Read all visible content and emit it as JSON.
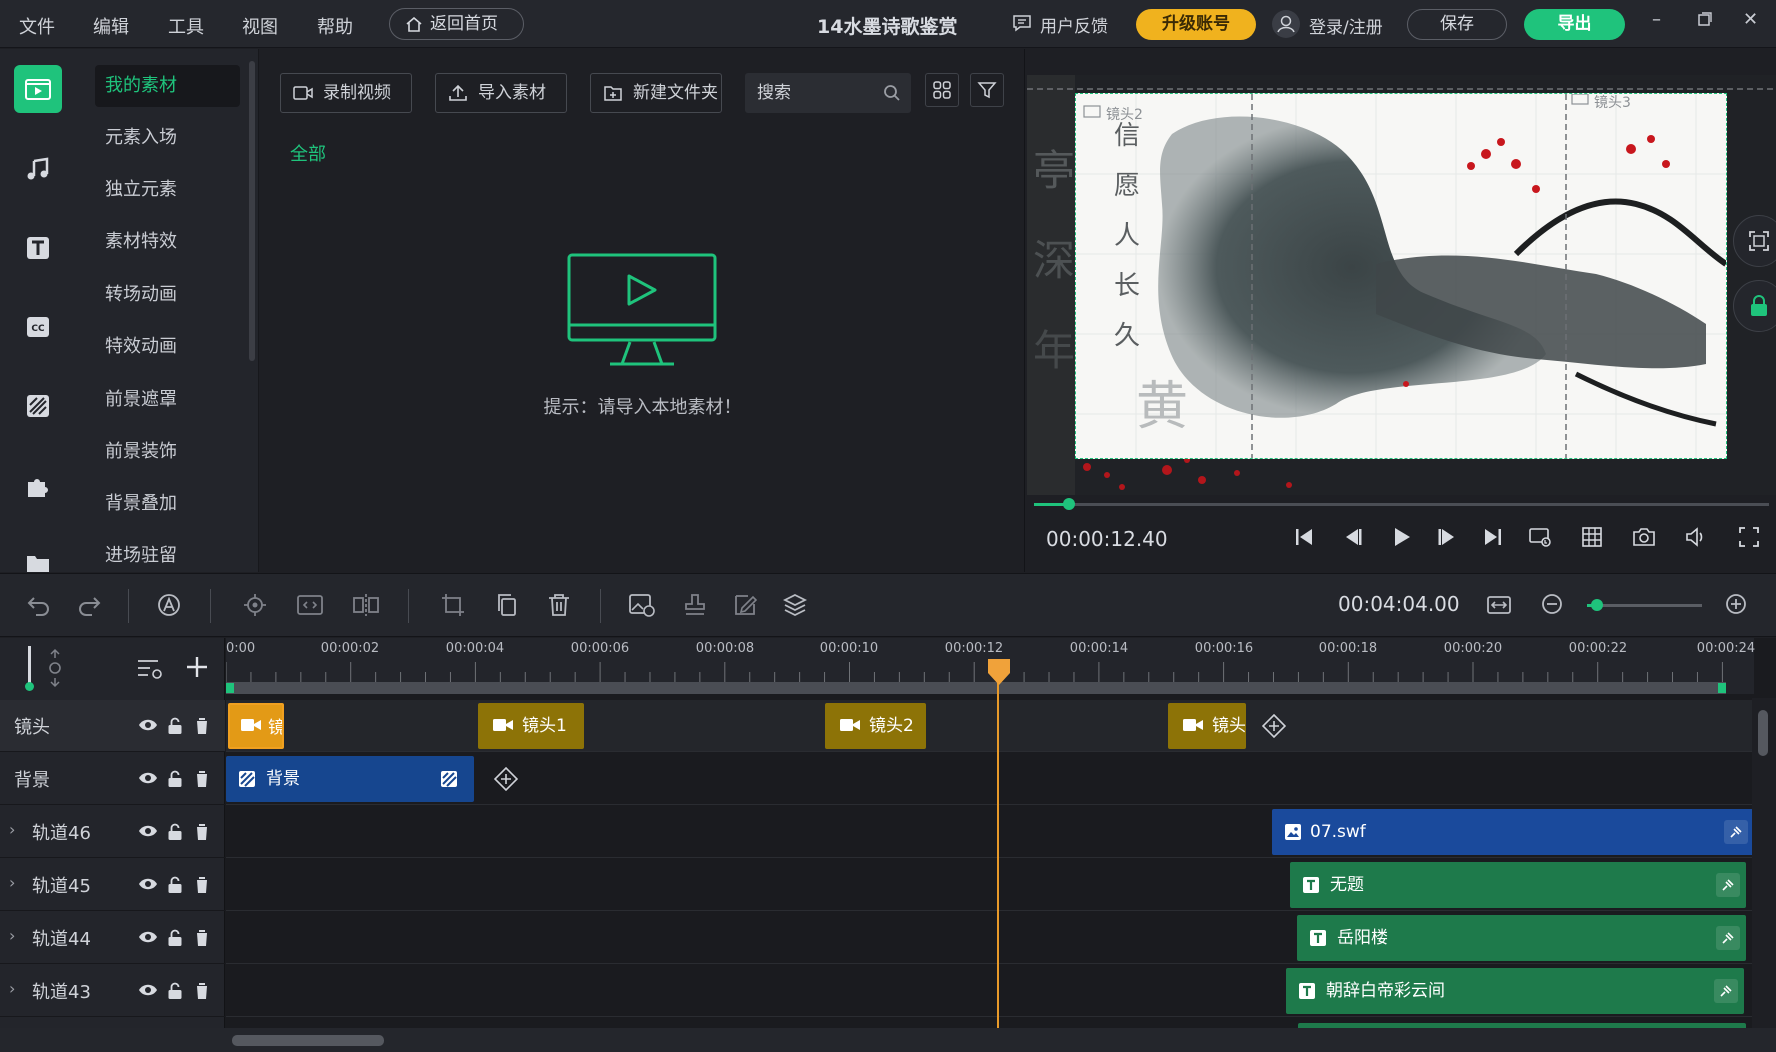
{
  "menu": {
    "items": [
      "文件",
      "编辑",
      "工具",
      "视图",
      "帮助"
    ],
    "home_button": "返回首页",
    "title": "14水墨诗歌鉴赏",
    "feedback": "用户反馈",
    "upgrade": "升级账号",
    "login": "登录/注册",
    "save": "保存",
    "export": "导出"
  },
  "sidebar": {
    "categories": [
      "我的素材",
      "元素入场",
      "独立元素",
      "素材特效",
      "转场动画",
      "特效动画",
      "前景遮罩",
      "前景装饰",
      "背景叠加",
      "进场驻留"
    ]
  },
  "media": {
    "record": "录制视频",
    "import": "导入素材",
    "new_folder": "新建文件夹",
    "search_placeholder": "搜索",
    "filter_all": "全部",
    "empty_tip": "提示：请导入本地素材！"
  },
  "preview": {
    "time": "00:00:12.40",
    "scene_label_2": "镜头2",
    "scene_label_3": "镜头3",
    "scrub_progress": 0.045
  },
  "toolbar": {
    "duration": "00:04:04.00",
    "zoom_level": 0.08
  },
  "timeline": {
    "ruler": [
      "0:00",
      "00:00:02",
      "00:00:04",
      "00:00:06",
      "00:00:08",
      "00:00:10",
      "00:00:12",
      "00:00:14",
      "00:00:16",
      "00:00:18",
      "00:00:20",
      "00:00:22",
      "00:00:24"
    ],
    "playhead_time": "00:00:12.40",
    "tracks": [
      {
        "name": "镜头",
        "expandable": false
      },
      {
        "name": "背景",
        "expandable": false
      },
      {
        "name": "轨道46",
        "expandable": true
      },
      {
        "name": "轨道45",
        "expandable": true
      },
      {
        "name": "轨道44",
        "expandable": true
      },
      {
        "name": "轨道43",
        "expandable": true
      }
    ],
    "clips": {
      "cam0": "镜",
      "cam1": "镜头1",
      "cam2": "镜头2",
      "cam3": "镜头",
      "bg": "背景",
      "t46": "07.swf",
      "t45": "无题",
      "t44": "岳阳楼",
      "t43": "朝辞白帝彩云间"
    }
  },
  "colors": {
    "accent": "#1fc37c",
    "upgrade": "#f0b21e",
    "playhead": "#e89a2a",
    "camera_clip": "#8d7307",
    "text_clip": "#1e7a4b",
    "image_clip": "#1a4a9c"
  }
}
